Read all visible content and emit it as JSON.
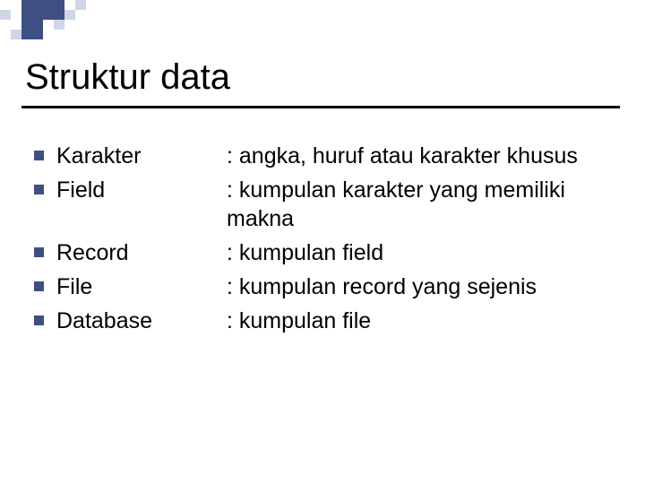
{
  "title": "Struktur data",
  "items": [
    {
      "term": "Karakter",
      "desc": ": angka, huruf atau karakter khusus"
    },
    {
      "term": "Field",
      "desc": ": kumpulan karakter yang memiliki makna"
    },
    {
      "term": "Record",
      "desc": ": kumpulan field"
    },
    {
      "term": "File",
      "desc": ": kumpulan record yang sejenis"
    },
    {
      "term": "Database",
      "desc": ": kumpulan file"
    }
  ]
}
